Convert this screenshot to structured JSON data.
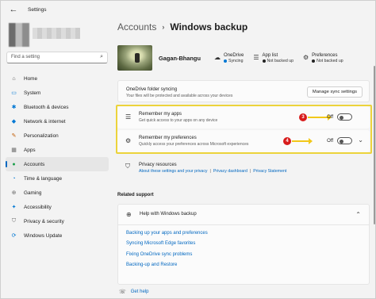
{
  "window": {
    "title": "Settings"
  },
  "sidebar": {
    "search_placeholder": "Find a setting",
    "items": [
      {
        "label": "Home",
        "icon": "home-icon",
        "glyph": "⌂",
        "color": "#555555"
      },
      {
        "label": "System",
        "icon": "system-icon",
        "glyph": "▭",
        "color": "#0078d4"
      },
      {
        "label": "Bluetooth & devices",
        "icon": "bluetooth-icon",
        "glyph": "✱",
        "color": "#0078d4"
      },
      {
        "label": "Network & internet",
        "icon": "network-icon",
        "glyph": "◆",
        "color": "#0078d4"
      },
      {
        "label": "Personalization",
        "icon": "brush-icon",
        "glyph": "✎",
        "color": "#c05a00"
      },
      {
        "label": "Apps",
        "icon": "apps-icon",
        "glyph": "▦",
        "color": "#6b6b6b"
      },
      {
        "label": "Accounts",
        "icon": "accounts-icon",
        "glyph": "●",
        "color": "#1a9e4a"
      },
      {
        "label": "Time & language",
        "icon": "clock-icon",
        "glyph": "◔",
        "color": "#0078d4"
      },
      {
        "label": "Gaming",
        "icon": "gaming-icon",
        "glyph": "⊕",
        "color": "#6b6b6b"
      },
      {
        "label": "Accessibility",
        "icon": "accessibility-icon",
        "glyph": "✦",
        "color": "#0078d4"
      },
      {
        "label": "Privacy & security",
        "icon": "shield-icon",
        "glyph": "⛉",
        "color": "#6b6b6b"
      },
      {
        "label": "Windows Update",
        "icon": "update-icon",
        "glyph": "⟳",
        "color": "#0078d4"
      }
    ],
    "active_index": 6
  },
  "breadcrumb": {
    "parent": "Accounts",
    "separator": "›",
    "current": "Windows backup"
  },
  "account": {
    "name": "Gagan-Bhangu",
    "stats": [
      {
        "title": "OneDrive",
        "sub": "Syncing",
        "icon": "cloud-icon",
        "glyph": "☁",
        "dot_color": "#0078d4"
      },
      {
        "title": "App list",
        "sub": "Not backed up",
        "icon": "list-icon",
        "glyph": "☰",
        "dot_color": "#222222"
      },
      {
        "title": "Preferences",
        "sub": "Not backed up",
        "icon": "gear-icon",
        "glyph": "⚙",
        "dot_color": "#222222"
      }
    ]
  },
  "onedrive": {
    "title": "OneDrive folder syncing",
    "subtitle": "Your files will be protected and available across your devices",
    "button": "Manage sync settings"
  },
  "apps_row": {
    "title": "Remember my apps",
    "subtitle": "Get quick access to your apps on any device",
    "state": "Off",
    "callout": "3"
  },
  "prefs_row": {
    "title": "Remember my preferences",
    "subtitle": "Quickly access your preferences across Microsoft experiences",
    "state": "Off",
    "callout": "4"
  },
  "privacy": {
    "title": "Privacy resources",
    "links": [
      "About these settings and your privacy",
      "Privacy dashboard",
      "Privacy Statement"
    ],
    "separator": "|"
  },
  "related": {
    "section_title": "Related support",
    "help_title": "Help with Windows backup",
    "links": [
      "Backing up your apps and preferences",
      "Syncing Microsoft Edge favorites",
      "Fixing OneDrive sync problems",
      "Backing-up and Restore"
    ]
  },
  "footer": {
    "get_help": "Get help"
  },
  "colors": {
    "accent": "#0067c0",
    "highlight": "#ecd33b",
    "callout": "#d81c1c",
    "arrow": "#f2c81a"
  }
}
